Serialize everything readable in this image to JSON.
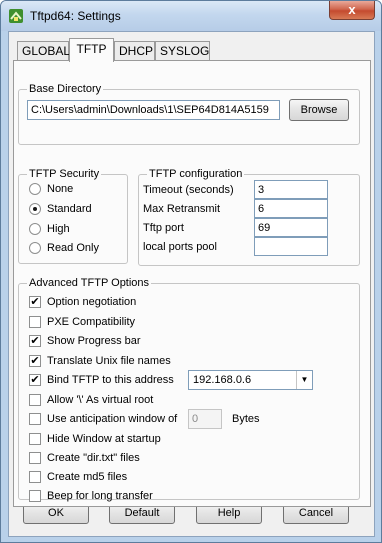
{
  "window": {
    "title": "Tftpd64: Settings",
    "close_glyph": "x"
  },
  "tabs": [
    "GLOBAL",
    "TFTP",
    "DHCP",
    "SYSLOG"
  ],
  "active_tab": "TFTP",
  "base_directory": {
    "label": "Base Directory",
    "value": "C:\\Users\\admin\\Downloads\\1\\SEP64D814A5159",
    "browse_label": "Browse"
  },
  "security": {
    "label": "TFTP Security",
    "options": [
      "None",
      "Standard",
      "High",
      "Read Only"
    ],
    "selected": "Standard"
  },
  "configuration": {
    "label": "TFTP configuration",
    "fields": [
      {
        "label": "Timeout (seconds)",
        "value": "3"
      },
      {
        "label": "Max Retransmit",
        "value": "6"
      },
      {
        "label": "Tftp port",
        "value": "69"
      },
      {
        "label": "local ports pool",
        "value": ""
      }
    ]
  },
  "advanced": {
    "label": "Advanced TFTP Options",
    "options": [
      {
        "label": "Option negotiation",
        "checked": true
      },
      {
        "label": "PXE Compatibility",
        "checked": false
      },
      {
        "label": "Show Progress bar",
        "checked": true
      },
      {
        "label": "Translate Unix file names",
        "checked": true
      },
      {
        "label": "Bind TFTP to this address",
        "checked": true
      },
      {
        "label": "Allow '\\' As virtual root",
        "checked": false
      },
      {
        "label": "Use anticipation window of",
        "checked": false
      },
      {
        "label": "Hide Window at startup",
        "checked": false
      },
      {
        "label": "Create \"dir.txt\" files",
        "checked": false
      },
      {
        "label": "Create md5 files",
        "checked": false
      },
      {
        "label": "Beep for long transfer",
        "checked": false
      }
    ],
    "bind_address": "192.168.0.6",
    "anticipation_value": "0",
    "anticipation_unit": "Bytes"
  },
  "buttons": {
    "ok": "OK",
    "default": "Default",
    "help": "Help",
    "cancel": "Cancel"
  },
  "check_glyph": "✔",
  "icons": {
    "app": "network-plug-icon",
    "close": "close-icon",
    "dropdown": "chevron-down-icon"
  }
}
